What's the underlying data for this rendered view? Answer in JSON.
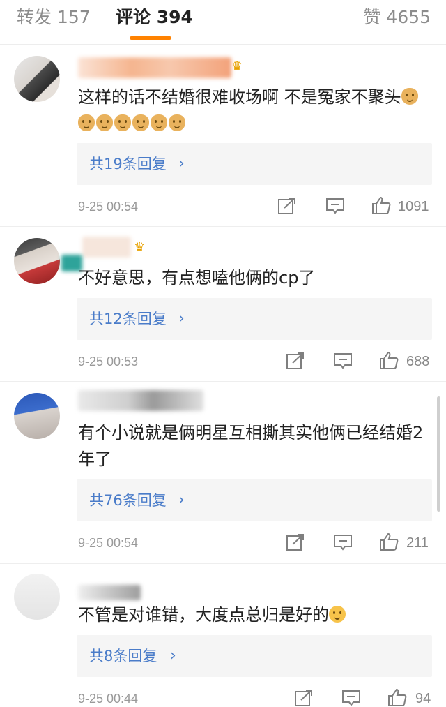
{
  "tabs": {
    "repost": "转发 157",
    "comments": "评论 394",
    "likes": "赞 4655"
  },
  "colors": {
    "accent": "#ff8200",
    "link": "#4a7cc9"
  },
  "comments": [
    {
      "text": "这样的话不结婚很难收场啊 不是冤家不聚头",
      "emoji_count": 7,
      "emoji": "dog-face-emoji",
      "replies_label": "共19条回复",
      "time": "9-25 00:54",
      "likes": "1091"
    },
    {
      "text": "不好意思，有点想嗑他俩的cp了",
      "replies_label": "共12条回复",
      "time": "9-25 00:53",
      "likes": "688"
    },
    {
      "text": "有个小说就是俩明星互相撕其实他俩已经结婚2年了",
      "replies_label": "共76条回复",
      "time": "9-25 00:54",
      "likes": "211"
    },
    {
      "text": "不管是对谁错，大度点总归是好的",
      "emoji": "smile-emoji",
      "replies_label": "共8条回复",
      "time": "9-25 00:44",
      "likes": "94"
    }
  ],
  "chevron": "›"
}
